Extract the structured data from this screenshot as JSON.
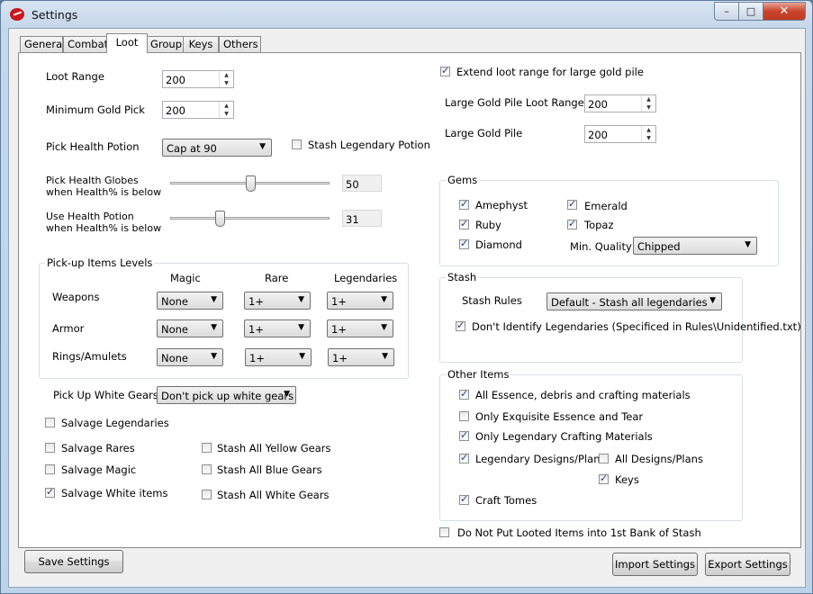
{
  "window": {
    "title": "Settings",
    "min_glyph": "–",
    "max_glyph": "□",
    "close_glyph": "✕"
  },
  "tabs": [
    "General",
    "Combat",
    "Loot",
    "Group",
    "Keys",
    "Others"
  ],
  "active_tab": "Loot",
  "loot": {
    "loot_range_label": "Loot Range",
    "loot_range": "200",
    "min_gold_label": "Minimum Gold Pick",
    "min_gold": "200",
    "pick_potion_label": "Pick Health Potion",
    "pick_potion_value": "Cap at 90",
    "stash_legendary_potion_label": "Stash Legendary Potion",
    "stash_legendary_potion": false,
    "globes_label_1": "Pick Health Globes",
    "globes_label_2": "when Health% is below",
    "globes_value": "50",
    "globes_level": 0.5,
    "potion_label_1": "Use Health Potion",
    "potion_label_2": "when Health% is below",
    "potion_value": "31",
    "potion_level": 0.31
  },
  "levels": {
    "title": "Pick-up Items Levels",
    "columns": [
      "Magic",
      "Rare",
      "Legendaries"
    ],
    "rows": [
      {
        "label": "Weapons",
        "values": [
          "None",
          "1+",
          "1+"
        ]
      },
      {
        "label": "Armor",
        "values": [
          "None",
          "1+",
          "1+"
        ]
      },
      {
        "label": "Rings/Amulets",
        "values": [
          "None",
          "1+",
          "1+"
        ]
      }
    ]
  },
  "white_gears": {
    "label": "Pick Up White Gears",
    "value": "Don't pick up white gears"
  },
  "salvage": {
    "legendaries": {
      "label": "Salvage Legendaries",
      "checked": false
    },
    "rares": {
      "label": "Salvage Rares",
      "checked": false
    },
    "magic": {
      "label": "Salvage Magic",
      "checked": false
    },
    "white": {
      "label": "Salvage White items",
      "checked": true
    }
  },
  "stash_gears": {
    "yellow": {
      "label": "Stash All Yellow Gears",
      "checked": false
    },
    "blue": {
      "label": "Stash All Blue Gears",
      "checked": false
    },
    "white": {
      "label": "Stash All White Gears",
      "checked": false
    }
  },
  "gold": {
    "extend_label": "Extend loot range for large gold pile",
    "extend_checked": true,
    "pile_range_label": "Large Gold Pile Loot Range",
    "pile_range": "200",
    "pile_label": "Large Gold Pile",
    "pile": "200"
  },
  "gems": {
    "title": "Gems",
    "amethyst": {
      "label": "Amephyst",
      "checked": true
    },
    "emerald": {
      "label": "Emerald",
      "checked": true
    },
    "ruby": {
      "label": "Ruby",
      "checked": true
    },
    "topaz": {
      "label": "Topaz",
      "checked": true
    },
    "diamond": {
      "label": "Diamond",
      "checked": true
    },
    "quality_label": "Min. Quality",
    "quality_value": "Chipped"
  },
  "stash": {
    "title": "Stash",
    "rules_label": "Stash Rules",
    "rules_value": "Default - Stash all legendaries",
    "dont_identify_label": "Don't Identify Legendaries (Specificed in Rules\\Unidentified.txt)",
    "dont_identify_checked": true
  },
  "other_items": {
    "title": "Other Items",
    "essence": {
      "label": "All Essence, debris and crafting materials",
      "checked": true
    },
    "exquisite": {
      "label": "Only Exquisite Essence and Tear",
      "checked": false
    },
    "legendary_crafting": {
      "label": "Only Legendary Crafting Materials",
      "checked": true
    },
    "legendary_designs": {
      "label": "Legendary Designs/Plans",
      "checked": true
    },
    "all_designs": {
      "label": "All Designs/Plans",
      "checked": false
    },
    "keys": {
      "label": "Keys",
      "checked": true
    },
    "craft_tomes": {
      "label": "Craft Tomes",
      "checked": true
    }
  },
  "bank": {
    "label": "Do Not Put Looted Items into 1st Bank of Stash",
    "checked": false
  },
  "buttons": {
    "save": "Save Settings",
    "import": "Import Settings",
    "export": "Export Settings"
  },
  "icons": {
    "caret": "▼",
    "up": "▲",
    "down": "▼"
  }
}
